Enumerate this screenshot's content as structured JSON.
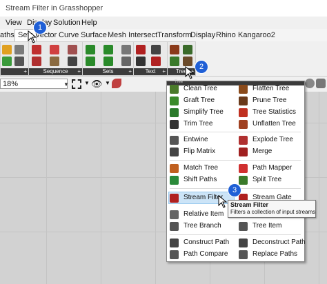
{
  "window": {
    "title": "Stream Filter in Grasshopper"
  },
  "menu": [
    "View",
    "Display",
    "Solution",
    "Help"
  ],
  "tabs": [
    "aths",
    "Sets",
    "Vector",
    "Curve",
    "Surface",
    "Mesh",
    "Intersect",
    "Transform",
    "Display",
    "Rhino",
    "Kangaroo2"
  ],
  "ribbon_panels": [
    "Sequence",
    "Sets",
    "Text",
    "Tree"
  ],
  "zoom": {
    "value": "18%"
  },
  "dropdown": {
    "header": "Tree",
    "left_items": [
      "Clean Tree",
      "Graft Tree",
      "Simplify Tree",
      "Trim Tree",
      "Entwine",
      "Flip Matrix",
      "Match Tree",
      "Shift Paths",
      "Stream Filter",
      "Relative Item",
      "Tree Branch",
      "Construct Path",
      "Path Compare"
    ],
    "right_items": [
      "Flatten Tree",
      "Prune Tree",
      "Tree Statistics",
      "Unflatten Tree",
      "Explode Tree",
      "Merge",
      "Path Mapper",
      "Split Tree",
      "Stream Gate",
      "Tree Item",
      "Deconstruct Path",
      "Replace Paths"
    ]
  },
  "tooltip": {
    "title": "Stream Filter",
    "description": "Filters a collection of input streams"
  },
  "badges": [
    "1",
    "2",
    "3"
  ],
  "colors": {
    "badge": "#1f5fd6",
    "highlight": "#cce4f7",
    "panel_bar": "#3c3c3c"
  }
}
